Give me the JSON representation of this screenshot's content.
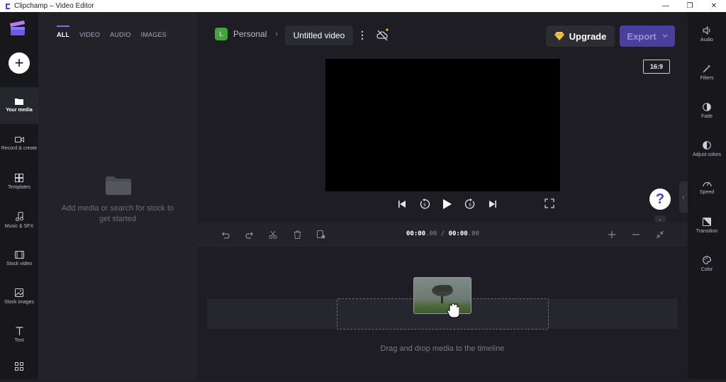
{
  "window": {
    "title": "Clipchamp – Video Editor",
    "minimize": "—",
    "maximize": "❐",
    "close": "✕"
  },
  "leftnav": {
    "add": "+",
    "items": [
      {
        "label": "Your media",
        "icon": "folder-icon",
        "active": true
      },
      {
        "label": "Record & create",
        "icon": "camera-icon"
      },
      {
        "label": "Templates",
        "icon": "templates-icon"
      },
      {
        "label": "Music & SFX",
        "icon": "music-icon"
      },
      {
        "label": "Stock video",
        "icon": "film-icon"
      },
      {
        "label": "Stock images",
        "icon": "image-icon"
      },
      {
        "label": "Text",
        "icon": "text-icon"
      },
      {
        "label": "",
        "icon": "more-icon"
      }
    ]
  },
  "media": {
    "tabs": [
      {
        "label": "ALL",
        "active": true
      },
      {
        "label": "VIDEO"
      },
      {
        "label": "AUDIO"
      },
      {
        "label": "IMAGES"
      }
    ],
    "empty_text": "Add media or search for stock to get started"
  },
  "header": {
    "workspace_initial": "L",
    "workspace": "Personal",
    "breadcrumb_sep": "›",
    "project_title": "Untitled video",
    "kebab": "⋮",
    "upgrade_label": "Upgrade",
    "export_label": "Export",
    "aspect_ratio": "16:9"
  },
  "help": {
    "label": "?"
  },
  "timeline": {
    "current_time": "00:00",
    "current_frames": ".00",
    "separator": " / ",
    "total_time": "00:00",
    "total_frames": ".00",
    "drop_text": "Drag and drop media to the timeline"
  },
  "rightpanel": {
    "items": [
      {
        "label": "Audio",
        "icon": "speaker-icon"
      },
      {
        "label": "Filters",
        "icon": "wand-icon"
      },
      {
        "label": "Fade",
        "icon": "fade-icon"
      },
      {
        "label": "Adjust colors",
        "icon": "contrast-icon"
      },
      {
        "label": "Speed",
        "icon": "speedometer-icon"
      },
      {
        "label": "Transition",
        "icon": "transition-icon"
      },
      {
        "label": "Color",
        "icon": "palette-icon"
      }
    ]
  },
  "colors": {
    "accent": "#7c6cf4",
    "export_bg": "#4a3f9c",
    "workspace_badge": "#3ea63a",
    "upgrade_gem": "#f5c542"
  }
}
